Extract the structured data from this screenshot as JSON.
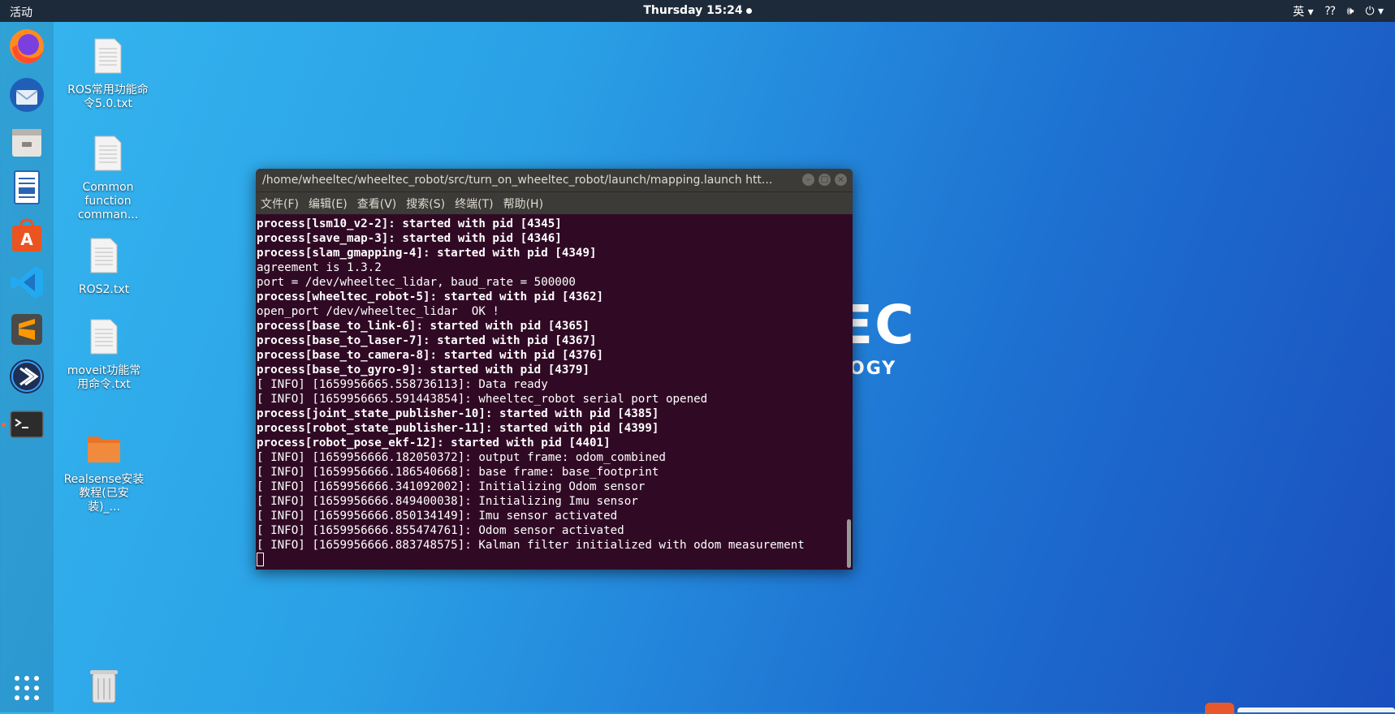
{
  "topbar": {
    "activities": "活动",
    "clock": "Thursday 15:24",
    "input_method": "英"
  },
  "dock": {
    "apps": [
      {
        "name": "firefox-icon"
      },
      {
        "name": "thunderbird-icon"
      },
      {
        "name": "files-icon"
      },
      {
        "name": "libreoffice-writer-icon"
      },
      {
        "name": "software-center-icon"
      },
      {
        "name": "vscode-icon"
      },
      {
        "name": "sublime-text-icon"
      },
      {
        "name": "app-blue-circle-icon"
      },
      {
        "name": "terminal-icon"
      }
    ]
  },
  "desktop": {
    "icons": [
      {
        "label": "ROS常用功能命令5.0.txt"
      },
      {
        "label": "Common function comman..."
      },
      {
        "label": "ROS2.txt"
      },
      {
        "label": "moveit功能常用命令.txt"
      },
      {
        "label": "Realsense安装教程(已安装)_..."
      }
    ]
  },
  "wallpaper": {
    "logo_big": "EC",
    "logo_small": "OGY"
  },
  "terminal": {
    "title": "/home/wheeltec/wheeltec_robot/src/turn_on_wheeltec_robot/launch/mapping.launch htt...",
    "menu": [
      "文件(F)",
      "编辑(E)",
      "查看(V)",
      "搜索(S)",
      "终端(T)",
      "帮助(H)"
    ],
    "lines": [
      {
        "text": "process[lsm10_v2-2]: started with pid [4345]",
        "bold": true
      },
      {
        "text": "process[save_map-3]: started with pid [4346]",
        "bold": true
      },
      {
        "text": "process[slam_gmapping-4]: started with pid [4349]",
        "bold": true
      },
      {
        "text": "agreement is 1.3.2",
        "bold": false
      },
      {
        "text": "port = /dev/wheeltec_lidar, baud_rate = 500000",
        "bold": false
      },
      {
        "text": "process[wheeltec_robot-5]: started with pid [4362]",
        "bold": true
      },
      {
        "text": "open_port /dev/wheeltec_lidar  OK !",
        "bold": false
      },
      {
        "text": "process[base_to_link-6]: started with pid [4365]",
        "bold": true
      },
      {
        "text": "process[base_to_laser-7]: started with pid [4367]",
        "bold": true
      },
      {
        "text": "process[base_to_camera-8]: started with pid [4376]",
        "bold": true
      },
      {
        "text": "process[base_to_gyro-9]: started with pid [4379]",
        "bold": true
      },
      {
        "text": "[ INFO] [1659956665.558736113]: Data ready",
        "bold": false
      },
      {
        "text": "[ INFO] [1659956665.591443854]: wheeltec_robot serial port opened",
        "bold": false
      },
      {
        "text": "process[joint_state_publisher-10]: started with pid [4385]",
        "bold": true
      },
      {
        "text": "process[robot_state_publisher-11]: started with pid [4399]",
        "bold": true
      },
      {
        "text": "process[robot_pose_ekf-12]: started with pid [4401]",
        "bold": true
      },
      {
        "text": "[ INFO] [1659956666.182050372]: output frame: odom_combined",
        "bold": false
      },
      {
        "text": "[ INFO] [1659956666.186540668]: base frame: base_footprint",
        "bold": false
      },
      {
        "text": "[ INFO] [1659956666.341092002]: Initializing Odom sensor",
        "bold": false
      },
      {
        "text": "[ INFO] [1659956666.849400038]: Initializing Imu sensor",
        "bold": false
      },
      {
        "text": "[ INFO] [1659956666.850134149]: Imu sensor activated",
        "bold": false
      },
      {
        "text": "[ INFO] [1659956666.855474761]: Odom sensor activated",
        "bold": false
      },
      {
        "text": "[ INFO] [1659956666.883748575]: Kalman filter initialized with odom measurement",
        "bold": false
      }
    ]
  }
}
